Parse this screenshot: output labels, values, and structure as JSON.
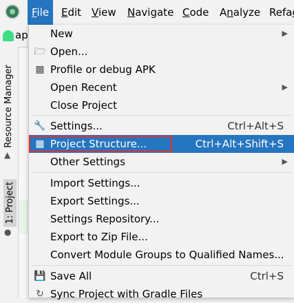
{
  "menubar": {
    "items": [
      {
        "label": "File",
        "mnemonic": "F",
        "rest": "ile"
      },
      {
        "label": "Edit",
        "mnemonic": "E",
        "rest": "dit"
      },
      {
        "label": "View",
        "mnemonic": "V",
        "rest": "iew"
      },
      {
        "label": "Navigate",
        "mnemonic": "N",
        "rest": "avigate"
      },
      {
        "label": "Code",
        "mnemonic": "C",
        "rest": "ode"
      },
      {
        "label": "Analyze",
        "pre": "A",
        "mnemonic": "n",
        "rest": "alyze"
      },
      {
        "label": "Refac",
        "pre": "Refa",
        "mnemonic": "c",
        "rest": ""
      }
    ]
  },
  "project_label": "ap",
  "side_tabs": {
    "resource_manager": "Resource Manager",
    "project": "1: Project"
  },
  "file_menu": {
    "new": "New",
    "open": "Open...",
    "profile_debug_apk": "Profile or debug APK",
    "open_recent": "Open Recent",
    "close_project": "Close Project",
    "settings": "Settings...",
    "settings_shortcut": "Ctrl+Alt+S",
    "project_structure": "Project Structure...",
    "project_structure_shortcut": "Ctrl+Alt+Shift+S",
    "other_settings": "Other Settings",
    "import_settings": "Import Settings...",
    "export_settings": "Export Settings...",
    "settings_repository": "Settings Repository...",
    "export_zip": "Export to Zip File...",
    "convert_module_groups": "Convert Module Groups to Qualified Names...",
    "save_all": "Save All",
    "save_all_shortcut": "Ctrl+S",
    "sync_gradle": "Sync Project with Gradle Files"
  },
  "colors": {
    "selection": "#2675bf",
    "annotation_box": "#e03131"
  }
}
